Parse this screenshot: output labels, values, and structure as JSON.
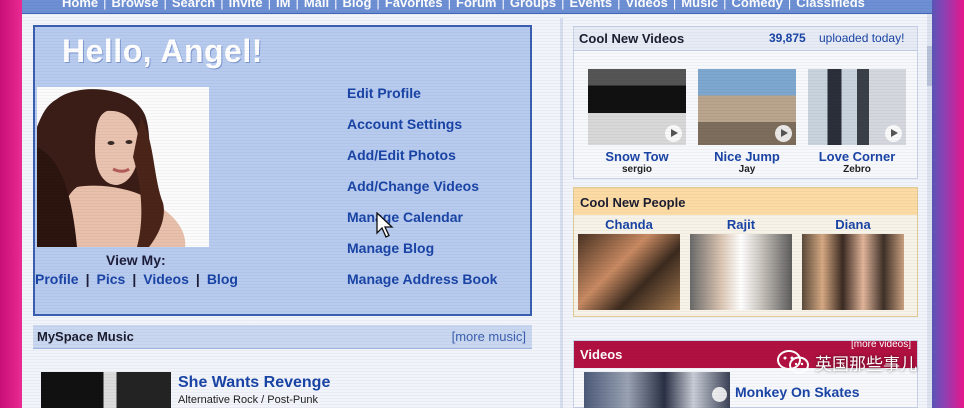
{
  "nav": {
    "items": [
      "Home",
      "Browse",
      "Search",
      "Invite",
      "IM",
      "Mail",
      "Blog",
      "Favorites",
      "Forum",
      "Groups",
      "Events",
      "Videos",
      "Music",
      "Comedy",
      "Classifieds"
    ],
    "separator": "|"
  },
  "profile": {
    "greeting": "Hello, Angel!",
    "view_my_label": "View My:",
    "view_my_links": [
      "Profile",
      "Pics",
      "Videos",
      "Blog"
    ],
    "view_my_separator": "|",
    "actions": [
      "Edit Profile",
      "Account Settings",
      "Add/Edit Photos",
      "Add/Change Videos",
      "Manage Calendar",
      "Manage Blog",
      "Manage Address Book"
    ]
  },
  "music": {
    "title": "MySpace Music",
    "more_link": "[more music]",
    "featured": {
      "name": "She Wants Revenge",
      "genre": "Alternative Rock / Post-Punk"
    }
  },
  "cool_videos": {
    "title": "Cool New Videos",
    "count": "39,875",
    "count_suffix": "uploaded today!",
    "items": [
      {
        "title": "Snow Tow",
        "user": "sergio"
      },
      {
        "title": "Nice Jump",
        "user": "Jay"
      },
      {
        "title": "Love Corner",
        "user": "Zebro"
      }
    ]
  },
  "cool_people": {
    "title": "Cool New People",
    "items": [
      "Chanda",
      "Rajit",
      "Diana"
    ]
  },
  "videos": {
    "title": "Videos",
    "more_link": "[more videos]",
    "featured": "Monkey On Skates"
  },
  "watermark": "英国那些事儿",
  "colors": {
    "nav_bar": "#6d8fd3",
    "link_blue": "#1a44a6",
    "profile_box": "#b7cbef",
    "people_header": "#fcdca4",
    "videos_header": "#b11140",
    "frame_magenta": "#e3177f"
  }
}
